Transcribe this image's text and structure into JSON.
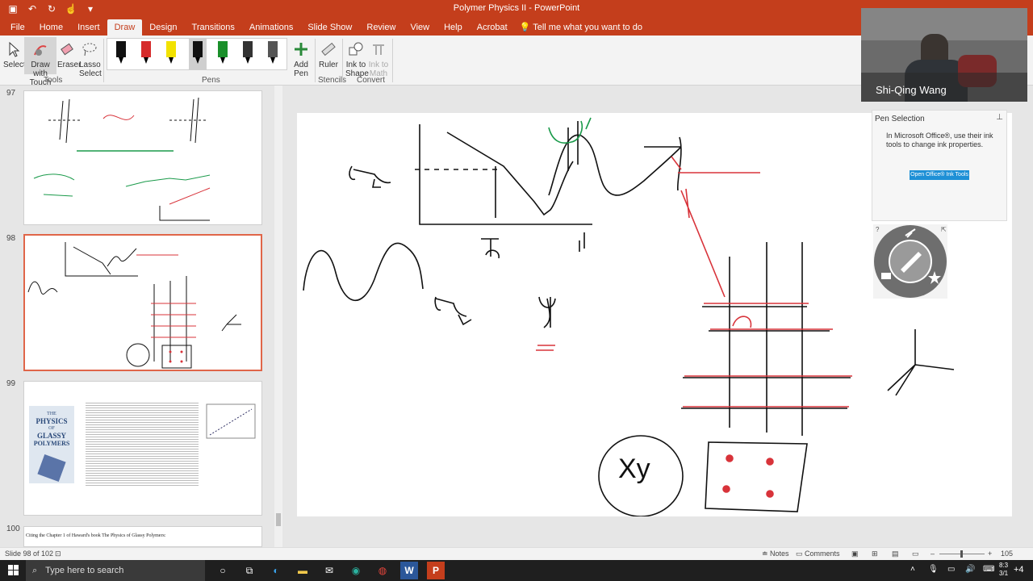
{
  "window": {
    "title": "Polymer Physics II  -  PowerPoint"
  },
  "ribbon_tabs": [
    "File",
    "Home",
    "Insert",
    "Draw",
    "Design",
    "Transitions",
    "Animations",
    "Slide Show",
    "Review",
    "View",
    "Help",
    "Acrobat"
  ],
  "tell_me": "Tell me what you want to do",
  "tools": {
    "select": "Select",
    "draw_touch_1": "Draw with",
    "draw_touch_2": "Touch",
    "eraser": "Eraser",
    "lasso_1": "Lasso",
    "lasso_2": "Select",
    "group": "Tools"
  },
  "pens_group": "Pens",
  "add_pen_1": "Add",
  "add_pen_2": "Pen",
  "ruler": "Ruler",
  "stencils_group": "Stencils",
  "ink_shape_1": "Ink to",
  "ink_shape_2": "Shape",
  "ink_math_1": "Ink to",
  "ink_math_2": "Math",
  "convert_group": "Convert",
  "pen_colors": [
    "#111111",
    "#d62b2b",
    "#f2e200",
    "#111111",
    "#1a8f2a",
    "#333333",
    "#333333",
    "#555555"
  ],
  "slides": [
    {
      "num": "97",
      "title": ""
    },
    {
      "num": "98",
      "title": ""
    },
    {
      "num": "99",
      "title": ""
    },
    {
      "num": "100",
      "title": "Citing the Chapter 1 of Haward's book The Physics of Glassy Polymers:"
    }
  ],
  "book_cover": {
    "line1": "THE",
    "line2": "PHYSICS",
    "line3": "OF",
    "line4": "GLASSY",
    "line5": "POLYMERS"
  },
  "webcam": {
    "name": "Shi-Qing Wang"
  },
  "pen_selection": {
    "title": "Pen Selection",
    "body": "In Microsoft Office®, use their ink tools to change ink properties.",
    "button": "Open Office® Ink Tools"
  },
  "status": {
    "slide_info": "Slide 98 of 102",
    "notes": "Notes",
    "comments": "Comments",
    "zoom": "105"
  },
  "taskbar": {
    "search_placeholder": "Type here to search",
    "clock_time": "8:3",
    "clock_date": "3/1",
    "overflow": "+4"
  },
  "colors": {
    "accent": "#c43e1c",
    "ink_red": "#d8333a",
    "ink_green": "#1a9a4a"
  }
}
